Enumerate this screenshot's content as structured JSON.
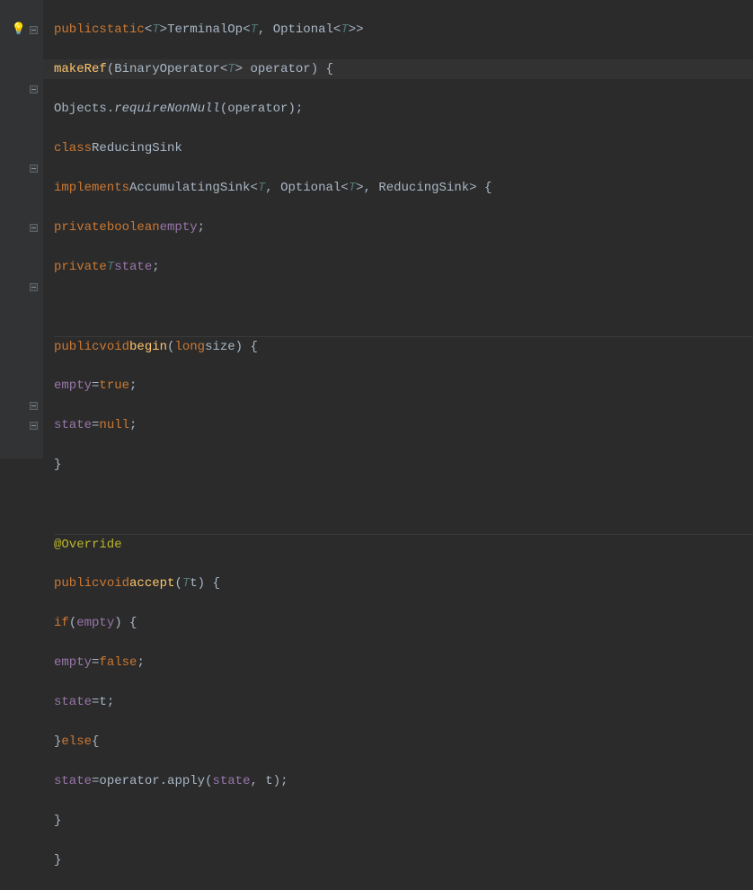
{
  "gutter": {
    "bulb": "💡",
    "fold": "−"
  },
  "code": {
    "l0_kw1": "public",
    "l0_kw2": "static",
    "l0_t1": "T",
    "l0_cls": "TerminalOp",
    "l0_t2": "T",
    "l0_cls2": "Optional",
    "l0_t3": "T",
    "l1_m": "makeRef",
    "l1_cls": "BinaryOperator",
    "l1_t": "T",
    "l1_p": "operator",
    "l2_cls": "Objects",
    "l2_m": "requireNonNull",
    "l2_p": "operator",
    "l3_kw": "class",
    "l3_cls": "ReducingSink",
    "l4_kw": "implements",
    "l4_cls": "AccumulatingSink",
    "l4_t1": "T",
    "l4_cls2": "Optional",
    "l4_t2": "T",
    "l4_cls3": "ReducingSink",
    "l5_kw1": "private",
    "l5_kw2": "boolean",
    "l5_f": "empty",
    "l6_kw": "private",
    "l6_t": "T",
    "l6_f": "state",
    "l8_kw1": "public",
    "l8_kw2": "void",
    "l8_m": "begin",
    "l8_kw3": "long",
    "l8_p": "size",
    "l9_f": "empty",
    "l9_kw": "true",
    "l10_f": "state",
    "l10_kw": "null",
    "l13_ann": "@Override",
    "l14_kw1": "public",
    "l14_kw2": "void",
    "l14_m": "accept",
    "l14_t": "T",
    "l14_p": "t",
    "l15_kw": "if",
    "l15_f": "empty",
    "l16_f": "empty",
    "l16_kw": "false",
    "l17_f": "state",
    "l17_p": "t",
    "l18_kw": "else",
    "l19_f": "state",
    "l19_p": "operator",
    "l19_m": "apply",
    "l19_f2": "state",
    "l19_p2": "t"
  }
}
